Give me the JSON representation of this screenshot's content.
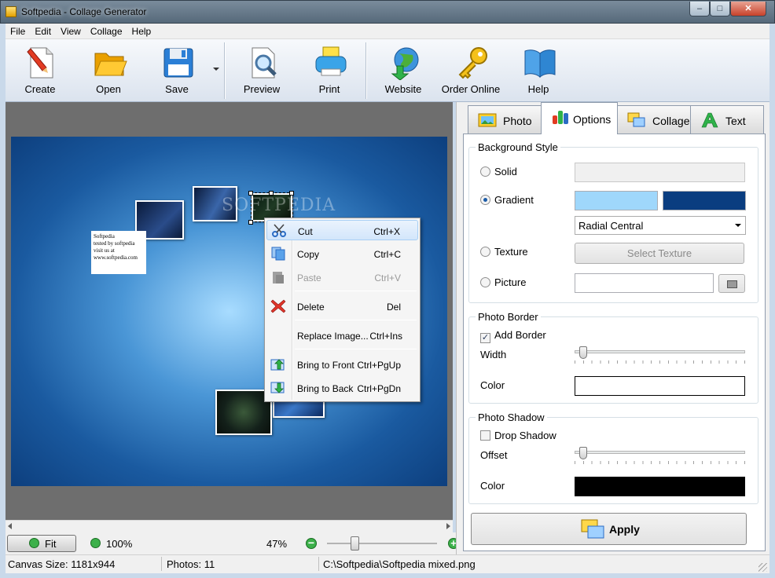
{
  "window": {
    "title": "Softpedia - Collage Generator",
    "minimize": "–",
    "maximize": "□",
    "close": "✕"
  },
  "menu": [
    "File",
    "Edit",
    "View",
    "Collage",
    "Help"
  ],
  "toolbar": {
    "create": "Create",
    "open": "Open",
    "save": "Save",
    "preview": "Preview",
    "print": "Print",
    "website": "Website",
    "order": "Order Online",
    "help": "Help"
  },
  "canvas": {
    "note_lines": [
      "Softpedia",
      "tested by softpedia",
      "visit us at www.softpedia.com"
    ],
    "watermark": "SOFTPEDIA"
  },
  "context_menu": [
    {
      "label": "Cut",
      "shortcut": "Ctrl+X",
      "icon": "scissors-icon",
      "enabled": true
    },
    {
      "label": "Copy",
      "shortcut": "Ctrl+C",
      "icon": "copy-icon",
      "enabled": true
    },
    {
      "label": "Paste",
      "shortcut": "Ctrl+V",
      "icon": "paste-icon",
      "enabled": false
    },
    {
      "label": "Delete",
      "shortcut": "Del",
      "icon": "delete-x-icon",
      "enabled": true
    },
    {
      "label": "Replace Image...",
      "shortcut": "Ctrl+Ins",
      "icon": "",
      "enabled": true
    },
    {
      "label": "Bring to Front",
      "shortcut": "Ctrl+PgUp",
      "icon": "bring-front-icon",
      "enabled": true
    },
    {
      "label": "Bring to Back",
      "shortcut": "Ctrl+PgDn",
      "icon": "send-back-icon",
      "enabled": true
    }
  ],
  "zoom": {
    "fit_label": "Fit",
    "actual_label": "100%",
    "percent": "47%",
    "slider_fraction": 0.25
  },
  "status": {
    "canvas_size": "Canvas Size: 1181x944",
    "photos": "Photos: 11",
    "file": "C:\\Softpedia\\Softpedia mixed.png"
  },
  "tabs": [
    "Photo",
    "Options",
    "Collage",
    "Text"
  ],
  "active_tab": "Options",
  "options": {
    "background": {
      "title": "Background Style",
      "solid": "Solid",
      "gradient": "Gradient",
      "texture": "Texture",
      "picture": "Picture",
      "selected": "Gradient",
      "gradient_color1": "#9fd7fb",
      "gradient_color2": "#0a3d80",
      "gradient_type": "Radial Central",
      "select_texture": "Select Texture"
    },
    "border": {
      "title": "Photo Border",
      "add_border": "Add Border",
      "add_border_checked": true,
      "width_label": "Width",
      "width_fraction": 0.03,
      "color_label": "Color",
      "color": "#ffffff"
    },
    "shadow": {
      "title": "Photo Shadow",
      "drop_shadow": "Drop Shadow",
      "drop_shadow_checked": false,
      "offset_label": "Offset",
      "offset_fraction": 0.03,
      "color_label": "Color",
      "color": "#000000"
    },
    "apply": "Apply"
  }
}
